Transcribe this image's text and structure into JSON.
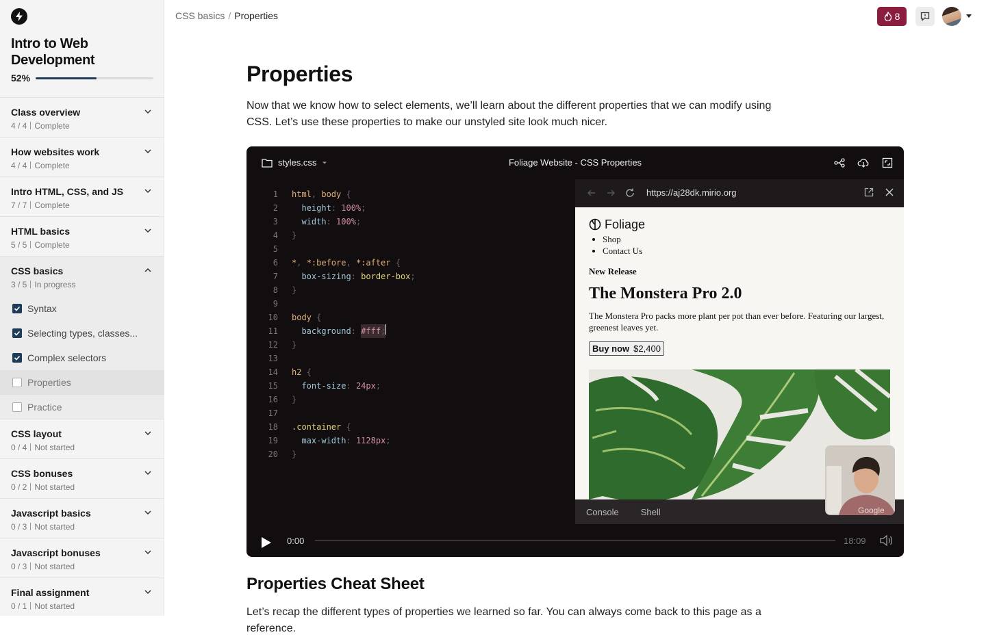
{
  "course": {
    "title": "Intro to Web Development",
    "progress_label": "52%",
    "progress_value": 0.52
  },
  "sections": [
    {
      "title": "Class overview",
      "count": "4 / 4",
      "status": "Complete"
    },
    {
      "title": "How websites work",
      "count": "4 / 4",
      "status": "Complete"
    },
    {
      "title": "Intro HTML, CSS, and JS",
      "count": "7 / 7",
      "status": "Complete"
    },
    {
      "title": "HTML basics",
      "count": "5 / 5",
      "status": "Complete"
    },
    {
      "title": "CSS basics",
      "count": "3 / 5",
      "status": "In progress",
      "open": true,
      "lessons": [
        {
          "label": "Syntax",
          "done": true
        },
        {
          "label": "Selecting types, classes...",
          "done": true
        },
        {
          "label": "Complex selectors",
          "done": true
        },
        {
          "label": "Properties",
          "done": false,
          "current": true
        },
        {
          "label": "Practice",
          "done": false
        }
      ]
    },
    {
      "title": "CSS layout",
      "count": "0 / 4",
      "status": "Not started"
    },
    {
      "title": "CSS bonuses",
      "count": "0 / 2",
      "status": "Not started"
    },
    {
      "title": "Javascript basics",
      "count": "0 / 3",
      "status": "Not started"
    },
    {
      "title": "Javascript bonuses",
      "count": "0 / 3",
      "status": "Not started"
    },
    {
      "title": "Final assignment",
      "count": "0 / 1",
      "status": "Not started"
    }
  ],
  "header": {
    "breadcrumb_parent": "CSS basics",
    "breadcrumb_sep": "/",
    "breadcrumb_current": "Properties",
    "streak_count": "8",
    "accent": "#8b1e3f"
  },
  "page": {
    "title": "Properties",
    "intro": "Now that we know how to select elements, we’ll learn about the different properties that we can modify using CSS. Let’s use these properties to make our unstyled site look much nicer.",
    "cheat_title": "Properties Cheat Sheet",
    "recap": "Let’s recap the different types of properties we learned so far. You can always come back to this page as a reference."
  },
  "player": {
    "file_name": "styles.css",
    "title": "Foliage Website - CSS Properties",
    "current_time": "0:00",
    "duration": "18:09",
    "progress": 0,
    "browser_url": "https://aj28dk.mirio.org",
    "console_tabs": [
      "Console",
      "Shell"
    ],
    "code_lines": [
      [
        [
          "sel",
          "html"
        ],
        [
          "pun",
          ", "
        ],
        [
          "sel",
          "body"
        ],
        [
          "pun",
          " {"
        ]
      ],
      [
        [
          "txt",
          "  "
        ],
        [
          "prop",
          "height"
        ],
        [
          "pun",
          ": "
        ],
        [
          "val",
          "100%"
        ],
        [
          "pun",
          ";"
        ]
      ],
      [
        [
          "txt",
          "  "
        ],
        [
          "prop",
          "width"
        ],
        [
          "pun",
          ": "
        ],
        [
          "val",
          "100%"
        ],
        [
          "pun",
          ";"
        ]
      ],
      [
        [
          "pun",
          "}"
        ]
      ],
      [],
      [
        [
          "sel",
          "*"
        ],
        [
          "pun",
          ", "
        ],
        [
          "sel",
          "*:before"
        ],
        [
          "pun",
          ", "
        ],
        [
          "sel",
          "*:after"
        ],
        [
          "pun",
          " {"
        ]
      ],
      [
        [
          "txt",
          "  "
        ],
        [
          "prop",
          "box-sizing"
        ],
        [
          "pun",
          ": "
        ],
        [
          "cls",
          "border-box"
        ],
        [
          "pun",
          ";"
        ]
      ],
      [
        [
          "pun",
          "}"
        ]
      ],
      [],
      [
        [
          "sel",
          "body"
        ],
        [
          "pun",
          " {"
        ]
      ],
      [
        [
          "txt",
          "  "
        ],
        [
          "prop",
          "background"
        ],
        [
          "pun",
          ": "
        ],
        [
          "val hl",
          "#fff"
        ],
        [
          "pun hl",
          ";"
        ],
        [
          "cursor",
          ""
        ]
      ],
      [
        [
          "pun",
          "}"
        ]
      ],
      [],
      [
        [
          "sel",
          "h2"
        ],
        [
          "pun",
          " {"
        ]
      ],
      [
        [
          "txt",
          "  "
        ],
        [
          "prop",
          "font-size"
        ],
        [
          "pun",
          ": "
        ],
        [
          "val",
          "24px"
        ],
        [
          "pun",
          ";"
        ]
      ],
      [
        [
          "pun",
          "}"
        ]
      ],
      [],
      [
        [
          "cls",
          ".container"
        ],
        [
          "pun",
          " {"
        ]
      ],
      [
        [
          "txt",
          "  "
        ],
        [
          "prop",
          "max-width"
        ],
        [
          "pun",
          ": "
        ],
        [
          "val",
          "1128px"
        ],
        [
          "pun",
          ";"
        ]
      ],
      [
        [
          "pun",
          "}"
        ]
      ]
    ],
    "site": {
      "brand": "Foliage",
      "nav": [
        "Shop",
        "Contact Us"
      ],
      "kicker": "New Release",
      "heading": "The Monstera Pro 2.0",
      "description": "The Monstera Pro packs more plant per pot than ever before. Featuring our largest, greenest leaves yet.",
      "button_label": "Buy now",
      "button_price": "$2,400"
    },
    "webcam_text": "Google"
  }
}
